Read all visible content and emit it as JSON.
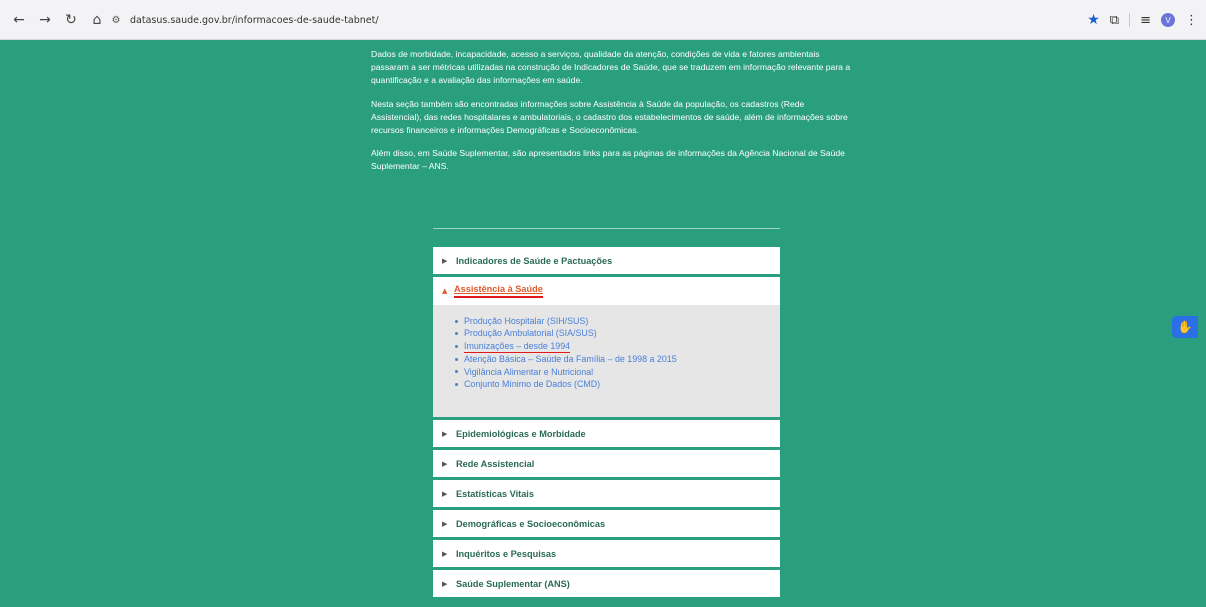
{
  "browser": {
    "url": "datasus.saude.gov.br/informacoes-de-saude-tabnet/",
    "profile_initial": "V"
  },
  "intro": {
    "p1": "Dados de morbidade, incapacidade, acesso a serviços, qualidade da atenção, condições de vida e fatores ambientais passaram a ser métricas utilizadas na construção de Indicadores de Saúde, que se traduzem em informação relevante para a quantificação e a avaliação das informações em saúde.",
    "p2": "Nesta seção também são encontradas informações sobre Assistência à Saúde da população, os cadastros (Rede Assistencial), das redes hospitalares e ambulatoriais, o cadastro dos estabelecimentos de saúde, além de informações sobre recursos financeiros e informações Demográficas e Socioeconômicas.",
    "p3": "Além disso, em Saúde Suplementar, são apresentados links para as páginas de informações da Agência Nacional de Saúde Suplementar – ANS."
  },
  "accordion": {
    "item_indicadores": "Indicadores de Saúde e Pactuações",
    "open_section": "Assistência à Saúde",
    "links": [
      "Produção Hospitalar (SIH/SUS)",
      "Produção Ambulatorial (SIA/SUS)",
      "Imunizações – desde 1994",
      "Atenção Básica – Saúde da Família – de 1998 a 2015",
      "Vigilância Alimentar e Nutricional",
      "Conjunto Mínimo de Dados (CMD)"
    ],
    "item_epidemio": "Epidemiológicas e Morbidade",
    "item_rede": "Rede Assistencial",
    "item_estatisticas": "Estatísticas Vitais",
    "item_demograficas": "Demográficas e Socioeconômicas",
    "item_inqueritos": "Inquéritos e Pesquisas",
    "item_suplementar": "Saúde Suplementar (ANS)"
  },
  "colors": {
    "page_bg": "#2a9f7f",
    "accent_open": "#e05a2b",
    "link": "#4a7fd8",
    "annotation_red": "#e01a1a"
  }
}
